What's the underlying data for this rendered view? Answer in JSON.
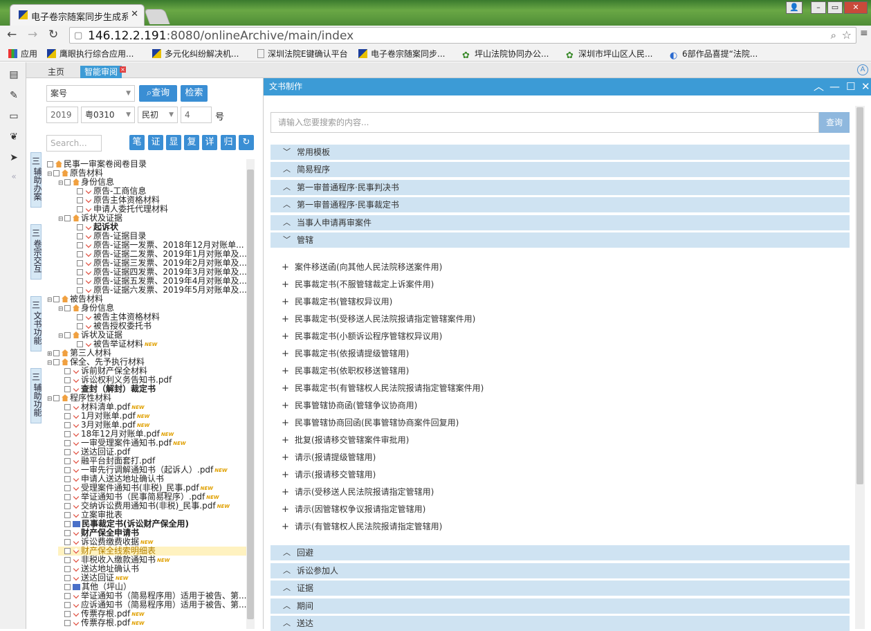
{
  "browser": {
    "tab_title": "电子卷宗随案同步生成系统",
    "url_host": "146.12.2.191",
    "url_rest": ":8080/onlineArchive/main/index",
    "bookmarks": [
      "应用",
      "鹰眼执行综合应用...",
      "多元化纠纷解决机...",
      "深圳法院E键确认平台",
      "电子卷宗随案同步...",
      "坪山法院协同办公...",
      "深圳市坪山区人民...",
      "6部作品喜提“法院..."
    ]
  },
  "app": {
    "tabs": [
      "主页",
      "智能审阅"
    ],
    "side_tabs": [
      "辅助办案",
      "卷宗交互",
      "文书功能",
      "辅助功能"
    ]
  },
  "filter": {
    "case_type": "案号",
    "query_label": "查询",
    "retrieve_label": "检索",
    "year": "2019",
    "court_code": "粤0310",
    "case_kind": "民初",
    "case_no": "4",
    "hao": "号",
    "search_placeholder": "Search...",
    "tool_buttons": [
      "笔",
      "证",
      "显",
      "复",
      "详",
      "归",
      "↻"
    ]
  },
  "tree": [
    {
      "text": "民事一审案卷阅卷目录",
      "lvl": 0,
      "icon": "folder",
      "ex": ""
    },
    {
      "text": "原告材料",
      "lvl": 1,
      "icon": "folder",
      "ex": "⊟"
    },
    {
      "text": "身份信息",
      "lvl": 2,
      "icon": "folder",
      "ex": "⊟"
    },
    {
      "text": "原告-工商信息",
      "lvl": 3,
      "icon": "doc",
      "ex": ""
    },
    {
      "text": "原告主体资格材料",
      "lvl": 3,
      "icon": "doc",
      "ex": ""
    },
    {
      "text": "申请人委托代理材料",
      "lvl": 3,
      "icon": "doc",
      "ex": ""
    },
    {
      "text": "诉状及证据",
      "lvl": 2,
      "icon": "folder",
      "ex": "⊟"
    },
    {
      "text": "起诉状",
      "lvl": 3,
      "icon": "doc",
      "ex": "",
      "bold": true
    },
    {
      "text": "原告-证据目录",
      "lvl": 3,
      "icon": "doc",
      "ex": ""
    },
    {
      "text": "原告-证据一发票、2018年12月对账单...",
      "lvl": 3,
      "icon": "doc",
      "ex": ""
    },
    {
      "text": "原告-证据二发票、2019年1月对账单及...",
      "lvl": 3,
      "icon": "doc",
      "ex": ""
    },
    {
      "text": "原告-证据三发票、2019年2月对账单及...",
      "lvl": 3,
      "icon": "doc",
      "ex": ""
    },
    {
      "text": "原告-证据四发票、2019年3月对账单及...",
      "lvl": 3,
      "icon": "doc",
      "ex": ""
    },
    {
      "text": "原告-证据五发票、2019年4月对账单及...",
      "lvl": 3,
      "icon": "doc",
      "ex": ""
    },
    {
      "text": "原告-证据六发票、2019年5月对账单及...",
      "lvl": 3,
      "icon": "doc",
      "ex": ""
    },
    {
      "text": "被告材料",
      "lvl": 1,
      "icon": "folder",
      "ex": "⊟"
    },
    {
      "text": "身份信息",
      "lvl": 2,
      "icon": "folder",
      "ex": "⊟"
    },
    {
      "text": "被告主体资格材料",
      "lvl": 3,
      "icon": "doc",
      "ex": ""
    },
    {
      "text": "被告授权委托书",
      "lvl": 3,
      "icon": "doc",
      "ex": ""
    },
    {
      "text": "诉状及证据",
      "lvl": 2,
      "icon": "folder",
      "ex": "⊟"
    },
    {
      "text": "被告举证材料",
      "lvl": 3,
      "icon": "doc",
      "ex": "",
      "new": true
    },
    {
      "text": "第三人材料",
      "lvl": 1,
      "icon": "folder",
      "ex": "⊞"
    },
    {
      "text": "保全、先予执行材料",
      "lvl": 1,
      "icon": "folder",
      "ex": "⊟"
    },
    {
      "text": "诉前财产保全材料",
      "lvl": 2,
      "icon": "doc",
      "ex": ""
    },
    {
      "text": "诉讼权利义务告知书.pdf",
      "lvl": 2,
      "icon": "doc",
      "ex": ""
    },
    {
      "text": "查封（解封）裁定书",
      "lvl": 2,
      "icon": "doc",
      "ex": "",
      "bold": true
    },
    {
      "text": "程序性材料",
      "lvl": 1,
      "icon": "folder",
      "ex": "⊟"
    },
    {
      "text": "材料清单.pdf",
      "lvl": 2,
      "icon": "doc",
      "ex": "",
      "new": true
    },
    {
      "text": "1月对账单.pdf",
      "lvl": 2,
      "icon": "doc",
      "ex": "",
      "new": true
    },
    {
      "text": "3月对账单.pdf",
      "lvl": 2,
      "icon": "doc",
      "ex": "",
      "new": true
    },
    {
      "text": "18年12月对账单.pdf",
      "lvl": 2,
      "icon": "doc",
      "ex": "",
      "new": true
    },
    {
      "text": "一审受理案件通知书.pdf",
      "lvl": 2,
      "icon": "doc",
      "ex": "",
      "new": true
    },
    {
      "text": "送达回证.pdf",
      "lvl": 2,
      "icon": "doc",
      "ex": ""
    },
    {
      "text": "融平台封面套打.pdf",
      "lvl": 2,
      "icon": "doc",
      "ex": ""
    },
    {
      "text": "一审先行调解通知书（起诉人）.pdf",
      "lvl": 2,
      "icon": "doc",
      "ex": "",
      "new": true
    },
    {
      "text": "申请人送达地址确认书",
      "lvl": 2,
      "icon": "doc",
      "ex": ""
    },
    {
      "text": "受理案件通知书(非税)_民事.pdf",
      "lvl": 2,
      "icon": "doc",
      "ex": "",
      "new": true
    },
    {
      "text": "举证通知书（民事简易程序）.pdf",
      "lvl": 2,
      "icon": "doc",
      "ex": "",
      "new": true
    },
    {
      "text": "交纳诉讼费用通知书(非税)_民事.pdf",
      "lvl": 2,
      "icon": "doc",
      "ex": "",
      "new": true
    },
    {
      "text": "立案审批表",
      "lvl": 2,
      "icon": "doc",
      "ex": ""
    },
    {
      "text": "民事裁定书(诉讼财产保全用)",
      "lvl": 2,
      "icon": "word",
      "ex": "",
      "bold": true
    },
    {
      "text": "财产保全申请书",
      "lvl": 2,
      "icon": "doc",
      "ex": "",
      "bold": true
    },
    {
      "text": "诉讼费缴费收据",
      "lvl": 2,
      "icon": "doc",
      "ex": "",
      "new": true
    },
    {
      "text": "财产保全线索明细表",
      "lvl": 2,
      "icon": "doc",
      "ex": "",
      "hl": true
    },
    {
      "text": "非税收入缴款通知书",
      "lvl": 2,
      "icon": "doc",
      "ex": "",
      "new": true
    },
    {
      "text": "送达地址确认书",
      "lvl": 2,
      "icon": "doc",
      "ex": ""
    },
    {
      "text": "送达回证",
      "lvl": 2,
      "icon": "doc",
      "ex": "",
      "new": true
    },
    {
      "text": "其他（坪山）",
      "lvl": 2,
      "icon": "word",
      "ex": ""
    },
    {
      "text": "举证通知书（简易程序用）适用于被告、第...",
      "lvl": 2,
      "icon": "doc",
      "ex": ""
    },
    {
      "text": "应诉通知书（简易程序用）适用于被告、第...",
      "lvl": 2,
      "icon": "doc",
      "ex": ""
    },
    {
      "text": "传票存根.pdf",
      "lvl": 2,
      "icon": "doc",
      "ex": "",
      "new": true
    },
    {
      "text": "传票存根.pdf",
      "lvl": 2,
      "icon": "doc",
      "ex": "",
      "new": true
    }
  ],
  "right": {
    "title": "文书制作",
    "search_placeholder": "请输入您要搜索的内容...",
    "search_btn": "查询",
    "sections_top": [
      {
        "label": "常用模板",
        "open": true
      },
      {
        "label": "简易程序",
        "open": false
      },
      {
        "label": "第一审普通程序·民事判决书",
        "open": false
      },
      {
        "label": "第一审普通程序·民事裁定书",
        "open": false
      },
      {
        "label": "当事人申请再审案件",
        "open": false
      },
      {
        "label": "管辖",
        "open": true
      }
    ],
    "items": [
      "案件移送函(向其他人民法院移送案件用)",
      "民事裁定书(不服管辖裁定上诉案件用)",
      "民事裁定书(管辖权异议用)",
      "民事裁定书(受移送人民法院报请指定管辖案件用)",
      "民事裁定书(小额诉讼程序管辖权异议用)",
      "民事裁定书(依报请提级管辖用)",
      "民事裁定书(依职权移送管辖用)",
      "民事裁定书(有管辖权人民法院报请指定管辖案件用)",
      "民事管辖协商函(管辖争议协商用)",
      "民事管辖协商回函(民事管辖协商案件回复用)",
      "批复(报请移交管辖案件审批用)",
      "请示(报请提级管辖用)",
      "请示(报请移交管辖用)",
      "请示(受移送人民法院报请指定管辖用)",
      "请示(因管辖权争议报请指定管辖用)",
      "请示(有管辖权人民法院报请指定管辖用)"
    ],
    "sections_bottom": [
      "回避",
      "诉讼参加人",
      "证据",
      "期间",
      "送达"
    ]
  }
}
